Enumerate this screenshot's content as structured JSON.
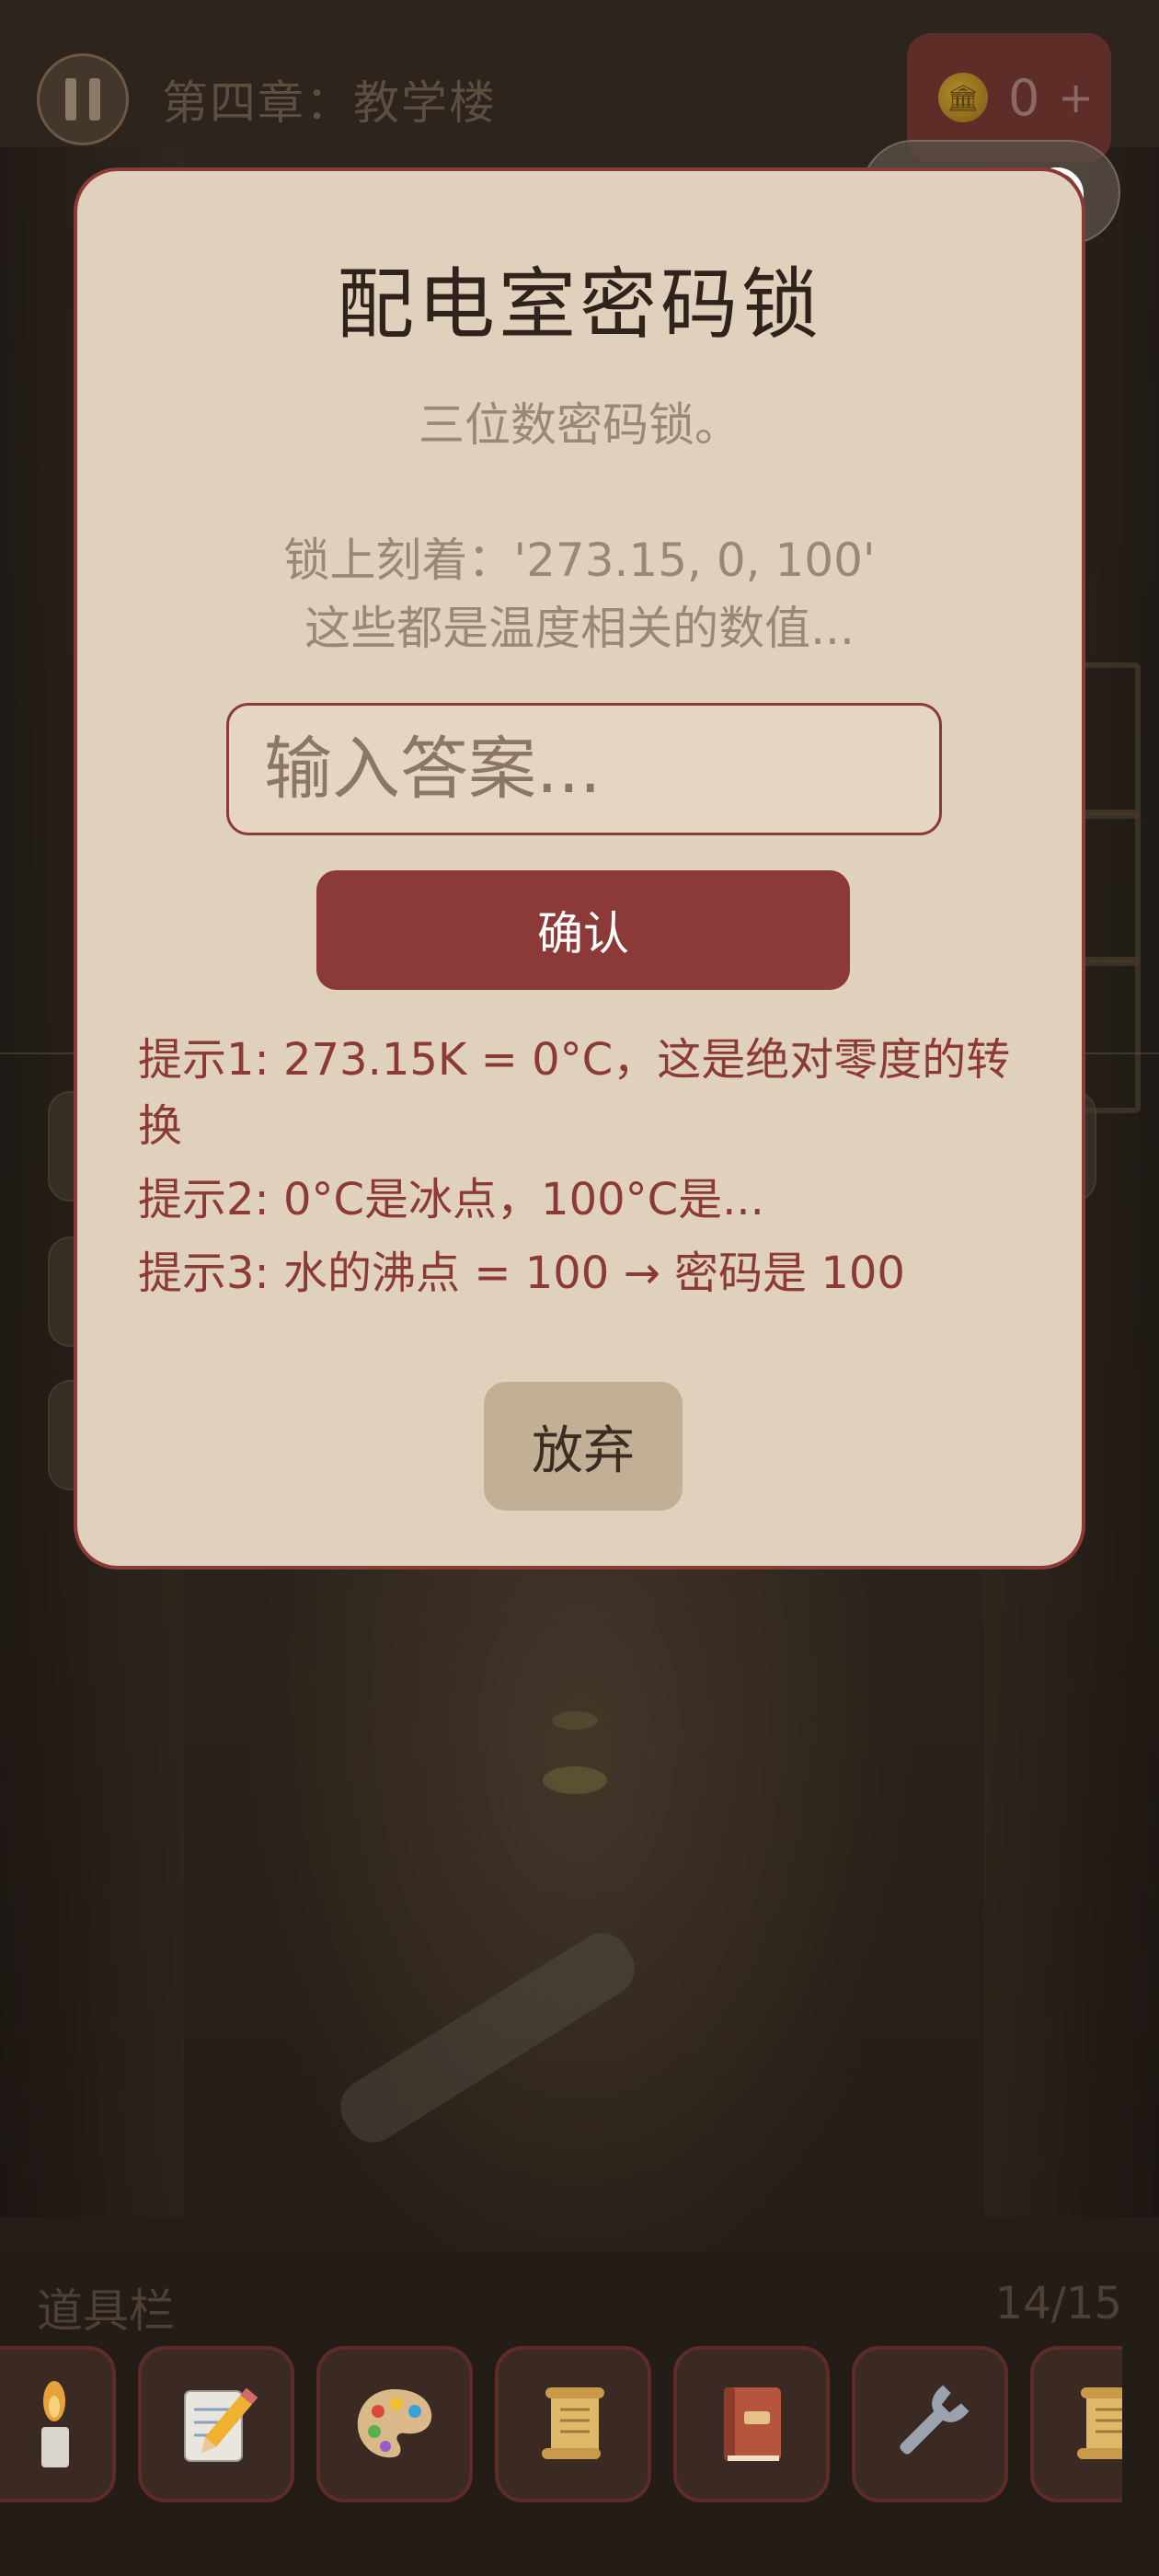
{
  "hud": {
    "chapter_title": "第四章：教学楼",
    "coin_count": "0",
    "coin_plus": "+"
  },
  "modal": {
    "title": "配电室密码锁",
    "subtitle": "三位数密码锁。",
    "clue_line1": "锁上刻着：'273.15, 0, 100'",
    "clue_line2": "这些都是温度相关的数值...",
    "input_placeholder": "输入答案...",
    "input_value": "",
    "confirm_label": "确认",
    "hints": [
      "提示1: 273.15K = 0°C，这是绝对零度的转换",
      "提示2: 0°C是冰点，100°C是...",
      "提示3: 水的沸点 = 100 → 密码是 100"
    ],
    "giveup_label": "放弃"
  },
  "inventory": {
    "title": "道具栏",
    "count": "14/15",
    "items": [
      {
        "icon": "candle-icon"
      },
      {
        "icon": "memo-pencil-icon"
      },
      {
        "icon": "palette-icon"
      },
      {
        "icon": "scroll-icon"
      },
      {
        "icon": "book-icon"
      },
      {
        "icon": "wrench-icon"
      },
      {
        "icon": "scroll-icon"
      }
    ]
  },
  "colors": {
    "accent": "#8c3a38",
    "modal_bg": "#e0d1bd",
    "button_secondary": "#c1b095"
  }
}
